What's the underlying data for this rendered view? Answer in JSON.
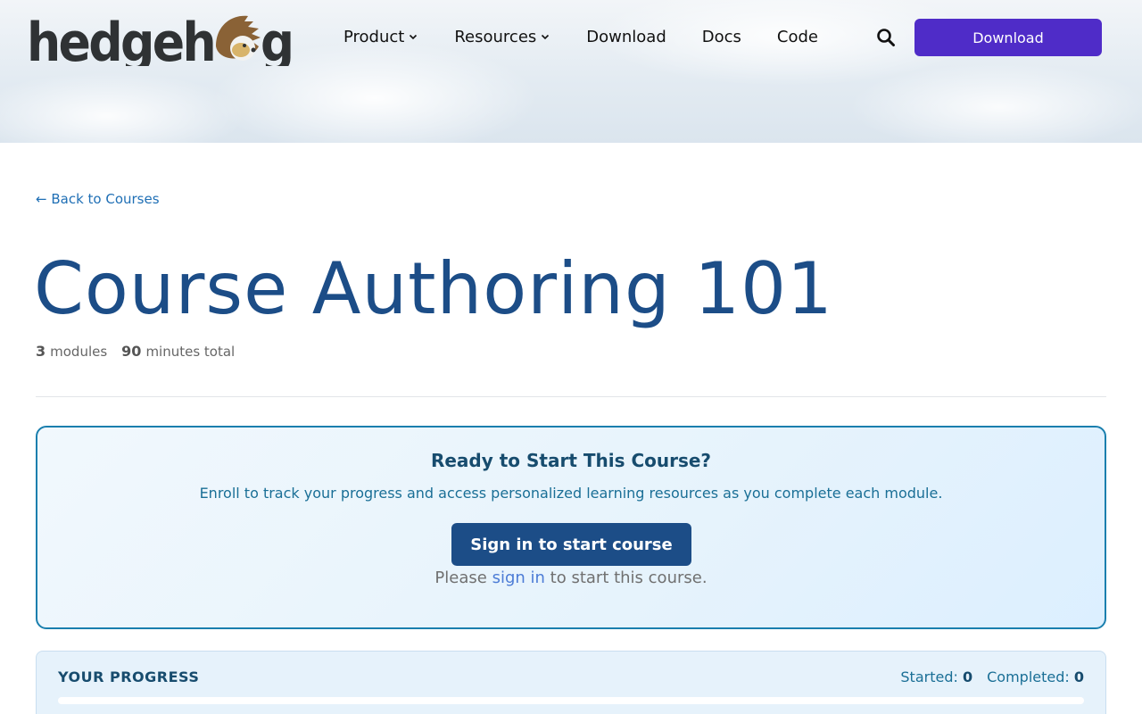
{
  "header": {
    "logo_text": "hedgehog",
    "nav": [
      {
        "label": "Product",
        "has_dropdown": true
      },
      {
        "label": "Resources",
        "has_dropdown": true
      },
      {
        "label": "Download",
        "has_dropdown": false
      },
      {
        "label": "Docs",
        "has_dropdown": false
      },
      {
        "label": "Code",
        "has_dropdown": false
      }
    ],
    "search_icon": "search-icon",
    "download_button": "Download"
  },
  "course": {
    "back_link": "← Back to Courses",
    "title": "Course Authoring 101",
    "modules_count": "3",
    "modules_label": "modules",
    "minutes_count": "90",
    "minutes_label": "minutes total"
  },
  "enroll": {
    "title": "Ready to Start This Course?",
    "description": "Enroll to track your progress and access personalized learning resources as you complete each module.",
    "button": "Sign in to start course",
    "note_prefix": "Please",
    "note_link": "sign in",
    "note_suffix": "to start this course."
  },
  "progress": {
    "title": "YOUR PROGRESS",
    "started_label": "Started:",
    "started_value": "0",
    "completed_label": "Completed:",
    "completed_value": "0",
    "fraction": 0
  },
  "colors": {
    "primary": "#1c4d87",
    "download_button": "#4f2cc8",
    "link": "#1f6fb5",
    "card_border": "#1a7fae"
  }
}
